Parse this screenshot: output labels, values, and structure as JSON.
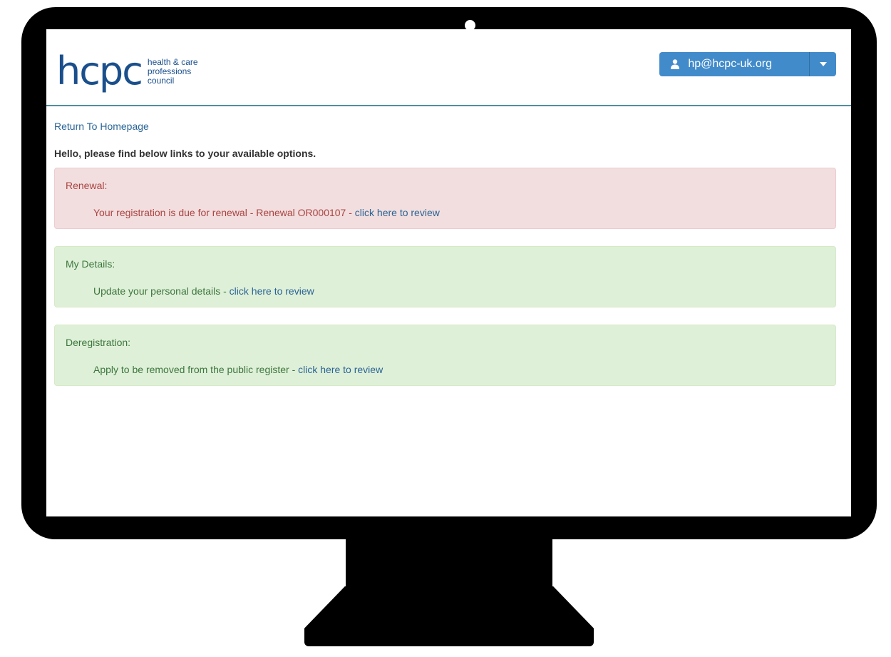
{
  "header": {
    "logo_word": "hcpc",
    "logo_tagline": [
      "health & care",
      "professions",
      "council"
    ],
    "user_email": "hp@hcpc-uk.org"
  },
  "nav": {
    "return_link": "Return To Homepage"
  },
  "intro": "Hello, please find below links to your available options.",
  "panels": [
    {
      "title": "Renewal:",
      "text": "Your registration is due for renewal - Renewal OR000107 - ",
      "link": "click here to review",
      "status": "danger"
    },
    {
      "title": "My Details:",
      "text": "Update your personal details - ",
      "link": "click here to review",
      "status": "success"
    },
    {
      "title": "Deregistration:",
      "text": "Apply to be removed from the public register - ",
      "link": "click here to review",
      "status": "success"
    }
  ],
  "colors": {
    "brand": "#1a4f8c",
    "button": "#428bca",
    "link": "#2a6496",
    "danger_bg": "#f2dede",
    "danger_text": "#a94442",
    "success_bg": "#dff0d8",
    "success_text": "#3c763d"
  },
  "icons": {
    "user": "user-icon",
    "caret": "caret-down-icon",
    "camera": "camera-icon"
  }
}
